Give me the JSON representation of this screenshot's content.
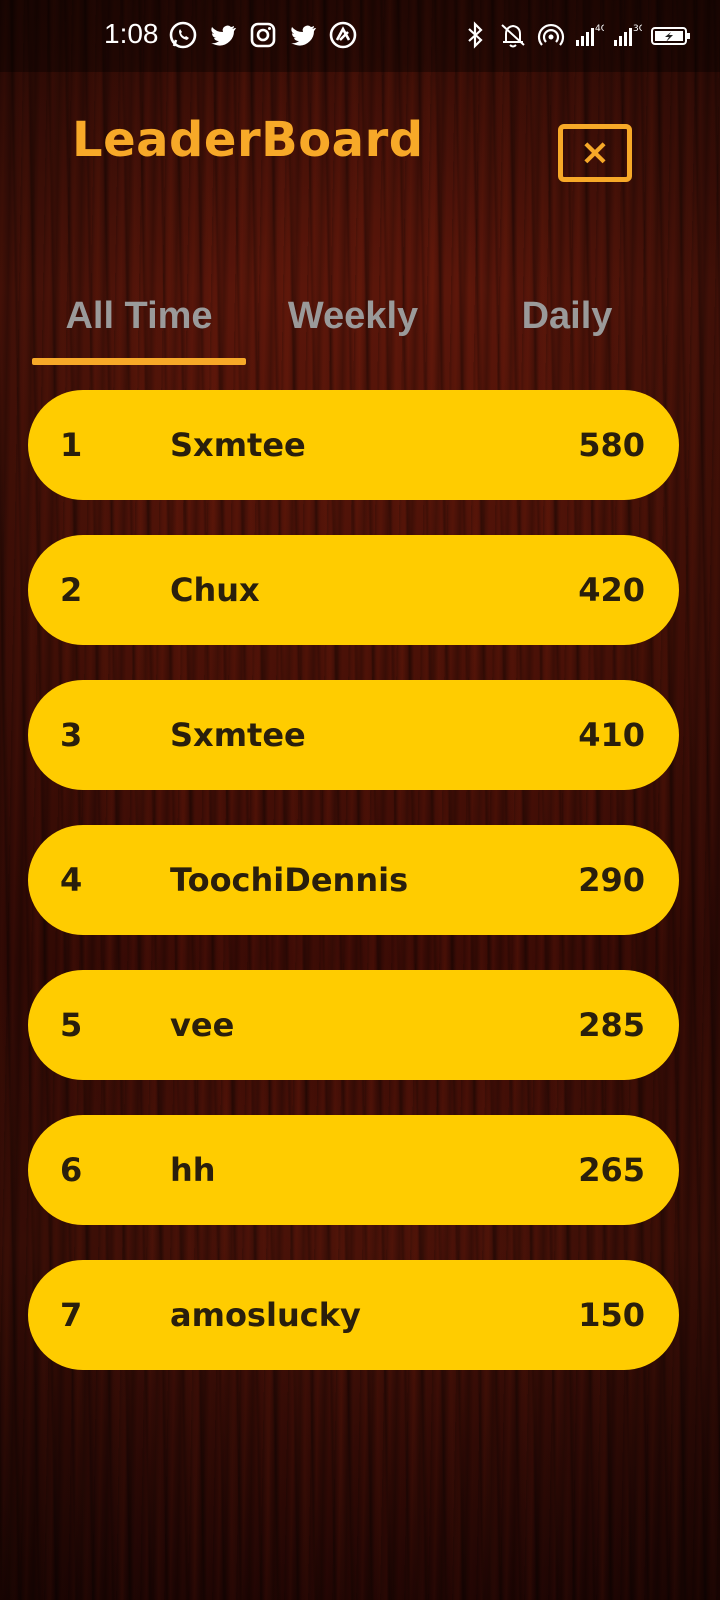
{
  "status_bar": {
    "time": "1:08",
    "left_icons": [
      "whatsapp-icon",
      "twitter-icon",
      "instagram-icon",
      "twitter-icon",
      "app-icon"
    ],
    "right_icons": [
      "bluetooth-icon",
      "bell-muted-icon",
      "hotspot-icon",
      "signal-4g-icon",
      "signal-3g-icon",
      "battery-charging-icon"
    ],
    "network_1": "4G",
    "network_2": "3G"
  },
  "header": {
    "title": "LeaderBoard",
    "close_label": "×"
  },
  "tabs": [
    {
      "label": "All Time",
      "active": true
    },
    {
      "label": "Weekly",
      "active": false
    },
    {
      "label": "Daily",
      "active": false
    }
  ],
  "leaderboard": [
    {
      "rank": "1",
      "name": "Sxmtee",
      "score": "580"
    },
    {
      "rank": "2",
      "name": "Chux",
      "score": "420"
    },
    {
      "rank": "3",
      "name": "Sxmtee",
      "score": "410"
    },
    {
      "rank": "4",
      "name": "ToochiDennis",
      "score": "290"
    },
    {
      "rank": "5",
      "name": "vee",
      "score": "285"
    },
    {
      "rank": "6",
      "name": "hh",
      "score": "265"
    },
    {
      "rank": "7",
      "name": "amoslucky",
      "score": "150"
    }
  ],
  "colors": {
    "accent": "#f7a928",
    "row_background": "#ffcc00",
    "row_text": "#2a1f0c",
    "tab_text": "#9a9a9a"
  }
}
